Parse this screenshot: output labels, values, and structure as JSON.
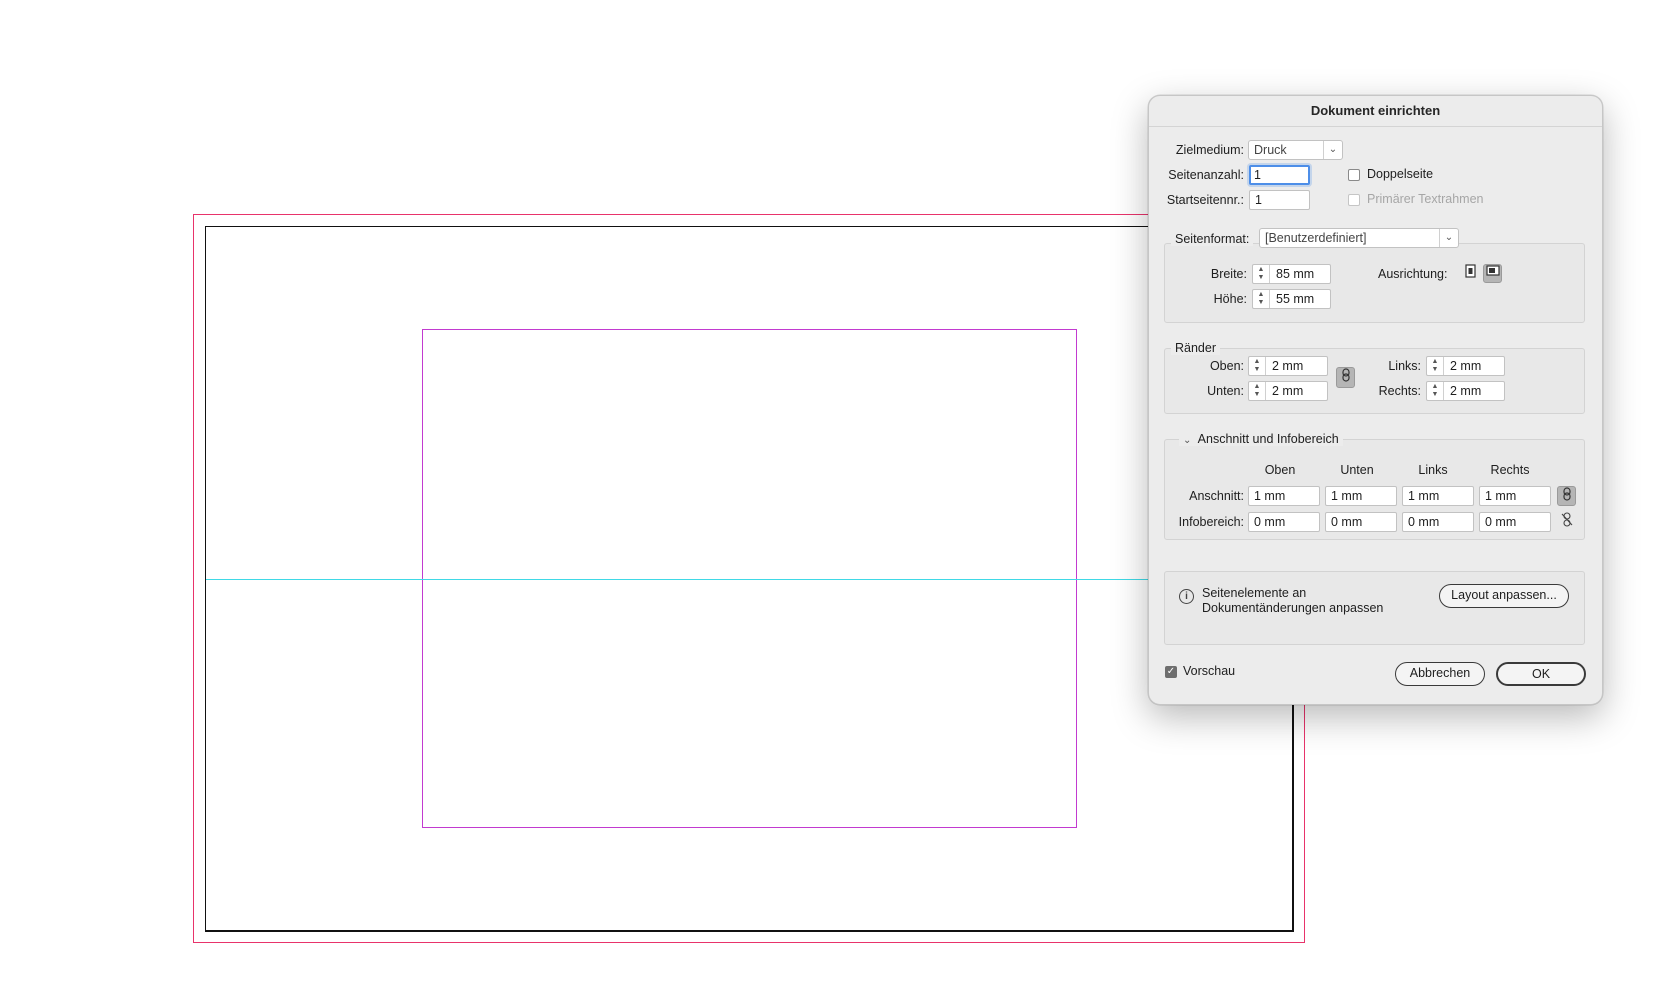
{
  "dialog": {
    "title": "Dokument einrichten",
    "zielmedium": {
      "label": "Zielmedium:",
      "value": "Druck"
    },
    "seitenanzahl": {
      "label": "Seitenanzahl:",
      "value": "1"
    },
    "startseitennr": {
      "label": "Startseitennr.:",
      "value": "1"
    },
    "doppelseite": {
      "label": "Doppelseite",
      "checked": false
    },
    "primaerer_textrahmen": {
      "label": "Primärer Textrahmen",
      "checked": false,
      "enabled": false
    },
    "seitenformat": {
      "label": "Seitenformat:",
      "value": "[Benutzerdefiniert]",
      "breite": {
        "label": "Breite:",
        "value": "85 mm"
      },
      "hoehe": {
        "label": "Höhe:",
        "value": "55 mm"
      },
      "ausrichtung_label": "Ausrichtung:"
    },
    "raender": {
      "title": "Ränder",
      "oben": {
        "label": "Oben:",
        "value": "2 mm"
      },
      "unten": {
        "label": "Unten:",
        "value": "2 mm"
      },
      "links": {
        "label": "Links:",
        "value": "2 mm"
      },
      "rechts": {
        "label": "Rechts:",
        "value": "2 mm"
      }
    },
    "anschnitt_infobereich": {
      "title": "Anschnitt und Infobereich",
      "columns": [
        "Oben",
        "Unten",
        "Links",
        "Rechts"
      ],
      "anschnitt": {
        "label": "Anschnitt:",
        "values": [
          "1 mm",
          "1 mm",
          "1 mm",
          "1 mm"
        ]
      },
      "infobereich": {
        "label": "Infobereich:",
        "values": [
          "0 mm",
          "0 mm",
          "0 mm",
          "0 mm"
        ]
      }
    },
    "layout_info": {
      "line1": "Seitenelemente an",
      "line2": "Dokumentänderungen anpassen",
      "button": "Layout anpassen..."
    },
    "vorschau": {
      "label": "Vorschau",
      "checked": true
    },
    "buttons": {
      "cancel": "Abbrechen",
      "ok": "OK"
    }
  },
  "colors": {
    "bleed_guide": "#e8336b",
    "margin_guide": "#c23ad0",
    "ruler_guide": "#3fd9e6",
    "focus_ring": "#4d8ee8"
  },
  "icons": [
    "chevron-down-icon",
    "portrait-icon",
    "landscape-icon",
    "link-icon",
    "unlink-icon",
    "info-icon",
    "checkmark-icon",
    "disclosure-triangle-icon"
  ]
}
